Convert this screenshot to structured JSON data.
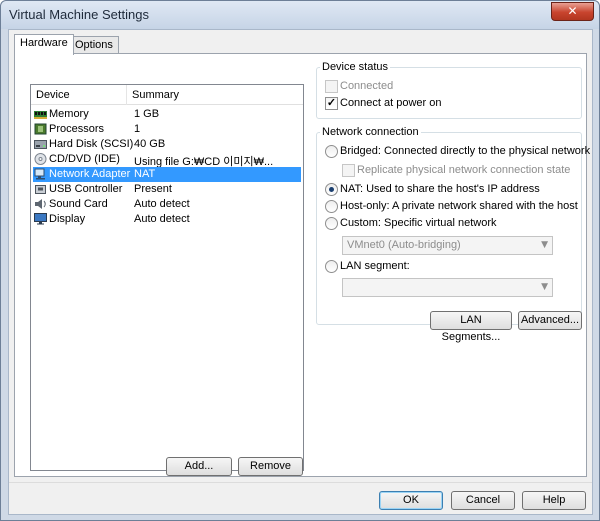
{
  "window": {
    "title": "Virtual Machine Settings",
    "close_glyph": "✕"
  },
  "tabs": [
    {
      "label": "Hardware",
      "active": true
    },
    {
      "label": "Options",
      "active": false
    }
  ],
  "device_list": {
    "columns": {
      "device": "Device",
      "summary": "Summary"
    },
    "selected_index": 4,
    "rows": [
      {
        "device": "Memory",
        "summary": "1 GB",
        "icon": "memory-icon"
      },
      {
        "device": "Processors",
        "summary": "1",
        "icon": "processor-icon"
      },
      {
        "device": "Hard Disk (SCSI)",
        "summary": "40 GB",
        "icon": "hard-disk-icon"
      },
      {
        "device": "CD/DVD (IDE)",
        "summary": "Using file G:₩CD 이미지₩...",
        "icon": "cd-dvd-icon"
      },
      {
        "device": "Network Adapter",
        "summary": "NAT",
        "icon": "network-adapter-icon"
      },
      {
        "device": "USB Controller",
        "summary": "Present",
        "icon": "usb-controller-icon"
      },
      {
        "device": "Sound Card",
        "summary": "Auto detect",
        "icon": "sound-card-icon"
      },
      {
        "device": "Display",
        "summary": "Auto detect",
        "icon": "display-icon"
      }
    ],
    "add_label": "Add...",
    "remove_label": "Remove"
  },
  "device_status": {
    "title": "Device status",
    "connected": {
      "label": "Connected",
      "checked": false,
      "enabled": false
    },
    "connect_at_power_on": {
      "label": "Connect at power on",
      "checked": true,
      "enabled": true
    },
    "check_glyph": "✓"
  },
  "network_connection": {
    "title": "Network connection",
    "bridged": {
      "label": "Bridged: Connected directly to the physical network",
      "selected": false
    },
    "replicate": {
      "label": "Replicate physical network connection state",
      "checked": false,
      "enabled": false
    },
    "nat": {
      "label": "NAT: Used to share the host's IP address",
      "selected": true
    },
    "host_only": {
      "label": "Host-only: A private network shared with the host",
      "selected": false
    },
    "custom": {
      "label": "Custom: Specific virtual network",
      "selected": false
    },
    "custom_network_value": "VMnet0 (Auto-bridging)",
    "lan_segment": {
      "label": "LAN segment:",
      "selected": false
    },
    "lan_segment_value": "",
    "dropdown_arrow": "▼"
  },
  "buttons": {
    "lan_segments": "LAN Segments...",
    "advanced": "Advanced...",
    "ok": "OK",
    "cancel": "Cancel",
    "help": "Help"
  }
}
